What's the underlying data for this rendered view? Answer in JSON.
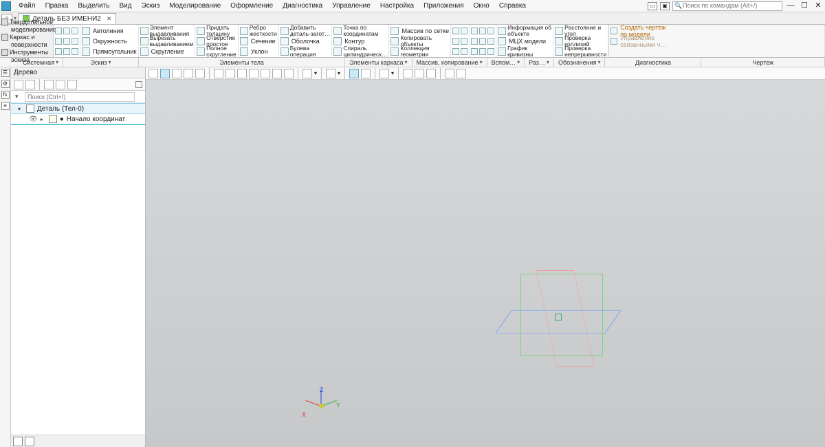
{
  "menubar": {
    "items": [
      "Файл",
      "Правка",
      "Выделить",
      "Вид",
      "Эскиз",
      "Моделирование",
      "Оформление",
      "Диагностика",
      "Управление",
      "Настройка",
      "Приложения",
      "Окно",
      "Справка"
    ]
  },
  "titlebar": {
    "search_placeholder": "Поиск по командам (Alt+/)"
  },
  "doc_tab": {
    "title": "Деталь БЕЗ ИМЕНИ2"
  },
  "ribbon_header": {
    "lines": [
      "Твердотельное",
      "моделирование",
      "Каркас и",
      "поверхности",
      "Инструменты",
      "эскиза"
    ]
  },
  "ribbon": {
    "sketch": {
      "autoline": "Автолиния",
      "circle": "Окружность",
      "rect": "Прямоугольник"
    },
    "feature": {
      "extrude": "Элемент\nвыдавливания",
      "cut": "Вырезать\nвыдавливанием",
      "fillet": "Скругление",
      "thicken": "Придать\nтолщину",
      "hole": "Отверстие\nпростое",
      "full_round": "Полное\nскругление",
      "rib": "Ребро\nжесткости",
      "section": "Сечение",
      "draft": "Уклон",
      "add_blank": "Добавить\nдеталь-загот…",
      "shell": "Оболочка",
      "boolean": "Булева\nоперация",
      "point": "Точка по\nкоординатам",
      "contour": "Контур",
      "spiral": "Спираль\nцилиндрическ…",
      "pattern": "Массив по сетке",
      "copy": "Копировать\nобъекты",
      "geom_coll": "Коллекция\nгеометрии",
      "info": "Информация об\nобъекте",
      "mass": "МЦХ модели",
      "curvature": "График\nкривизны",
      "dist_angle": "Расстояние и\nугол",
      "collision": "Проверка\nколлизий",
      "continuity": "Проверка\nнепрерывности"
    },
    "right_links": {
      "l1": "Создать чертеж\nпо модели",
      "l2": "Управление\nсвязанными ч…"
    }
  },
  "panel_tabs": [
    "Системная",
    "Эскиз",
    "Элементы тела",
    "Элементы каркаса",
    "Массив, копирование",
    "Вспом…",
    "Раз…",
    "Обозначения",
    "Диагностика",
    "Чертеж"
  ],
  "side": {
    "title": "Дерево",
    "search_placeholder": "Поиск (Ctrl+/)",
    "root": "Деталь (Тел-0)",
    "child": "Начало координат"
  },
  "axes": {
    "x": "X",
    "y": "Y",
    "z": "Z"
  }
}
